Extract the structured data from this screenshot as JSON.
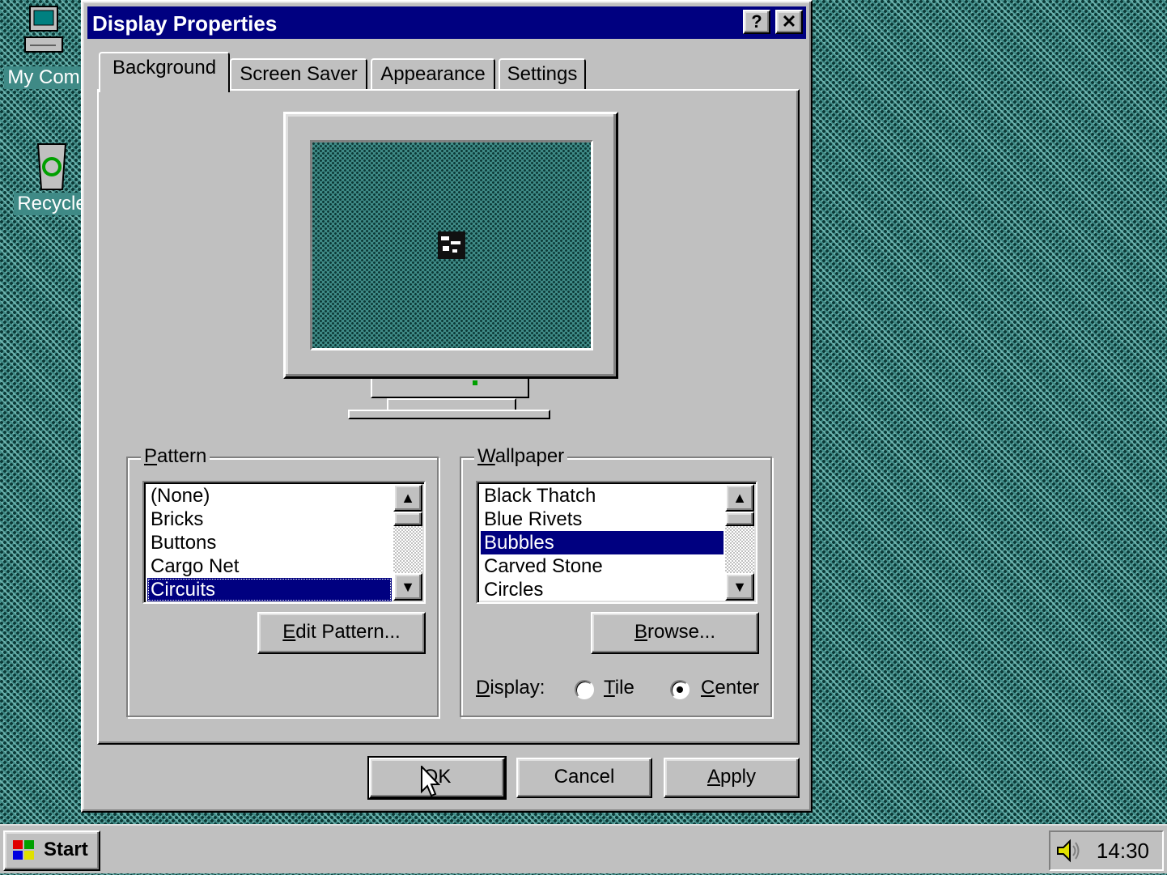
{
  "desktop": {
    "icons": [
      {
        "label": "My Com",
        "icon": "my-computer-icon"
      },
      {
        "label": "Recycle",
        "icon": "recycle-bin-icon"
      }
    ]
  },
  "dialog": {
    "title": "Display Properties",
    "help_button": "?",
    "close_button": "✕",
    "tabs": [
      {
        "label": "Background",
        "active": true
      },
      {
        "label": "Screen Saver",
        "active": false
      },
      {
        "label": "Appearance",
        "active": false
      },
      {
        "label": "Settings",
        "active": false
      }
    ],
    "pattern": {
      "label": "Pattern",
      "items": [
        "(None)",
        "Bricks",
        "Buttons",
        "Cargo Net",
        "Circuits"
      ],
      "selected": "Circuits",
      "edit_button": "Edit Pattern..."
    },
    "wallpaper": {
      "label": "Wallpaper",
      "items": [
        "Black Thatch",
        "Blue Rivets",
        "Bubbles",
        "Carved Stone",
        "Circles"
      ],
      "selected": "Bubbles",
      "browse_button": "Browse...",
      "display_label": "Display:",
      "tile_label": "Tile",
      "center_label": "Center",
      "display_mode": "Center"
    },
    "buttons": {
      "ok": "OK",
      "cancel": "Cancel",
      "apply": "Apply"
    }
  },
  "taskbar": {
    "start_label": "Start",
    "clock": "14:30",
    "tray_icon": "speaker-icon"
  },
  "colors": {
    "desktop": "#3f8a86",
    "titlebar": "#000080",
    "face": "#c0c0c0",
    "selection": "#000080"
  }
}
